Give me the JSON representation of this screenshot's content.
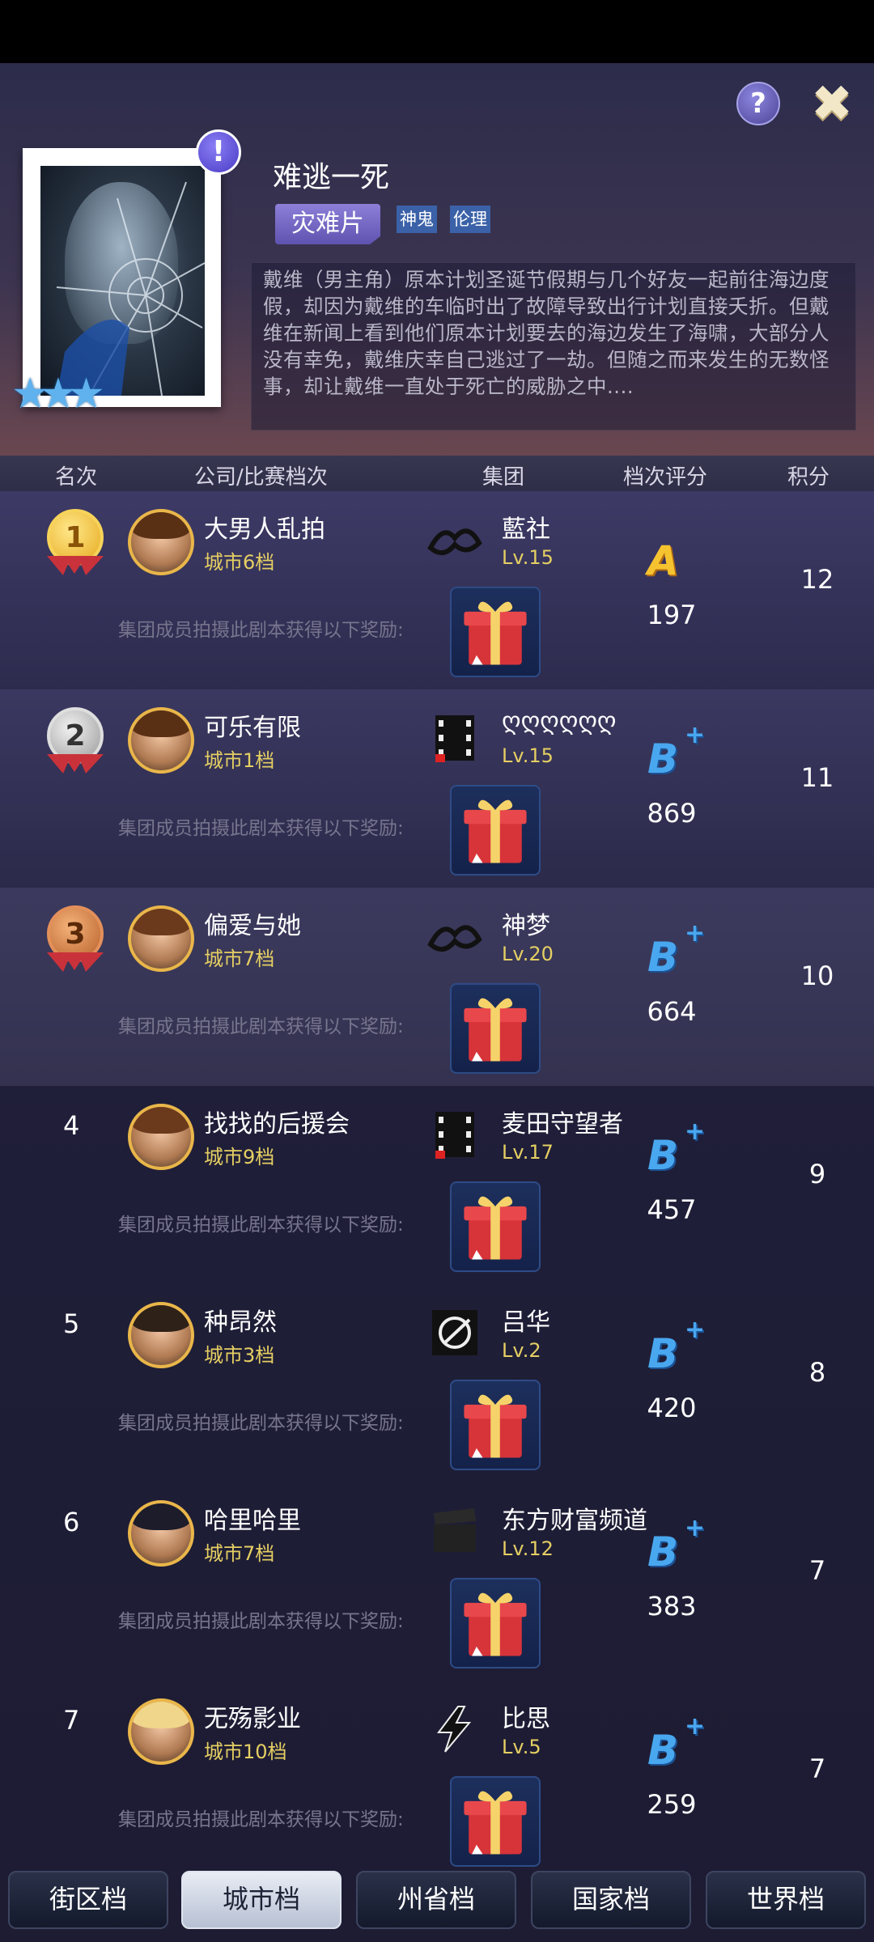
{
  "header": {
    "title": "难逃一死",
    "genre": "灾难片",
    "tags": [
      "神鬼",
      "伦理"
    ],
    "description": "戴维（男主角）原本计划圣诞节假期与几个好友一起前往海边度假，却因为戴维的车临时出了故障导致出行计划直接夭折。但戴维在新闻上看到他们原本计划要去的海边发生了海啸，大部分人没有幸免，戴维庆幸自己逃过了一劫。但随之而来发生的无数怪事，却让戴维一直处于死亡的威胁之中....",
    "help_label": "?",
    "close_label": "✖",
    "alert_label": "!",
    "stars": 3
  },
  "columns": {
    "rank": "名次",
    "company": "公司/比赛档次",
    "group": "集团",
    "grade": "档次评分",
    "points": "积分"
  },
  "reward_text": "集团成员拍摄此剧本获得以下奖励:",
  "rows": [
    {
      "rank": "1",
      "company": "大男人乱拍",
      "tier": "城市6档",
      "group": "藍社",
      "group_level": "Lv.15",
      "grade": "A",
      "grade_plus": "",
      "score": "197",
      "points": "12"
    },
    {
      "rank": "2",
      "company": "可乐有限",
      "tier": "城市1档",
      "group": "ღღღღღღ",
      "group_level": "Lv.15",
      "grade": "B",
      "grade_plus": "+",
      "score": "869",
      "points": "11"
    },
    {
      "rank": "3",
      "company": "偏爱与她",
      "tier": "城市7档",
      "group": "神梦",
      "group_level": "Lv.20",
      "grade": "B",
      "grade_plus": "+",
      "score": "664",
      "points": "10"
    },
    {
      "rank": "4",
      "company": "找找的后援会",
      "tier": "城市9档",
      "group": "麦田守望者",
      "group_level": "Lv.17",
      "grade": "B",
      "grade_plus": "+",
      "score": "457",
      "points": "9"
    },
    {
      "rank": "5",
      "company": "种昂然",
      "tier": "城市3档",
      "group": "吕华",
      "group_level": "Lv.2",
      "grade": "B",
      "grade_plus": "+",
      "score": "420",
      "points": "8"
    },
    {
      "rank": "6",
      "company": "哈里哈里",
      "tier": "城市7档",
      "group": "东方财富频道",
      "group_level": "Lv.12",
      "grade": "B",
      "grade_plus": "+",
      "score": "383",
      "points": "7"
    },
    {
      "rank": "7",
      "company": "无殇影业",
      "tier": "城市10档",
      "group": "比思",
      "group_level": "Lv.5",
      "grade": "B",
      "grade_plus": "+",
      "score": "259",
      "points": "7"
    }
  ],
  "tabs": [
    {
      "label": "街区档",
      "active": false
    },
    {
      "label": "城市档",
      "active": true
    },
    {
      "label": "州省档",
      "active": false
    },
    {
      "label": "国家档",
      "active": false
    },
    {
      "label": "世界档",
      "active": false
    }
  ],
  "colors": {
    "gold": "#e5cf63",
    "grade_a": "#f6c330",
    "grade_b": "#49a7ef",
    "tab_active": "#dfe4ee"
  }
}
